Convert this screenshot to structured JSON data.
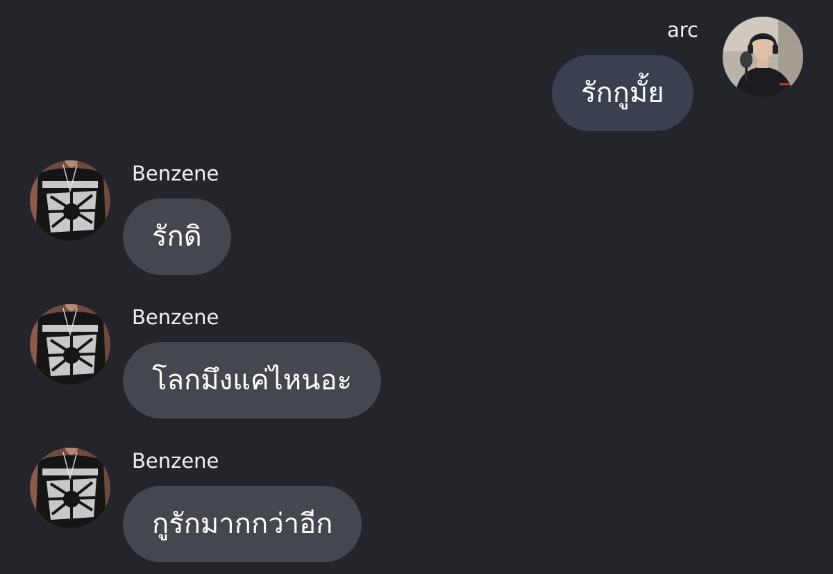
{
  "theme": {
    "background": "#24252b",
    "outgoing_bubble": "#3a4050",
    "incoming_bubble": "#45474e",
    "text": "#ffffff"
  },
  "messages": [
    {
      "direction": "outgoing",
      "sender": "arc",
      "text": "รักกูมั้ย",
      "avatar_icon": "user-avatar-icon"
    },
    {
      "direction": "incoming",
      "sender": "Benzene",
      "text": "รักดิ",
      "avatar_icon": "user-avatar-icon"
    },
    {
      "direction": "incoming",
      "sender": "Benzene",
      "text": "โลกมึงแค่ไหนอะ",
      "avatar_icon": "user-avatar-icon"
    },
    {
      "direction": "incoming",
      "sender": "Benzene",
      "text": "กูรักมากกว่าอีก",
      "avatar_icon": "user-avatar-icon"
    }
  ]
}
